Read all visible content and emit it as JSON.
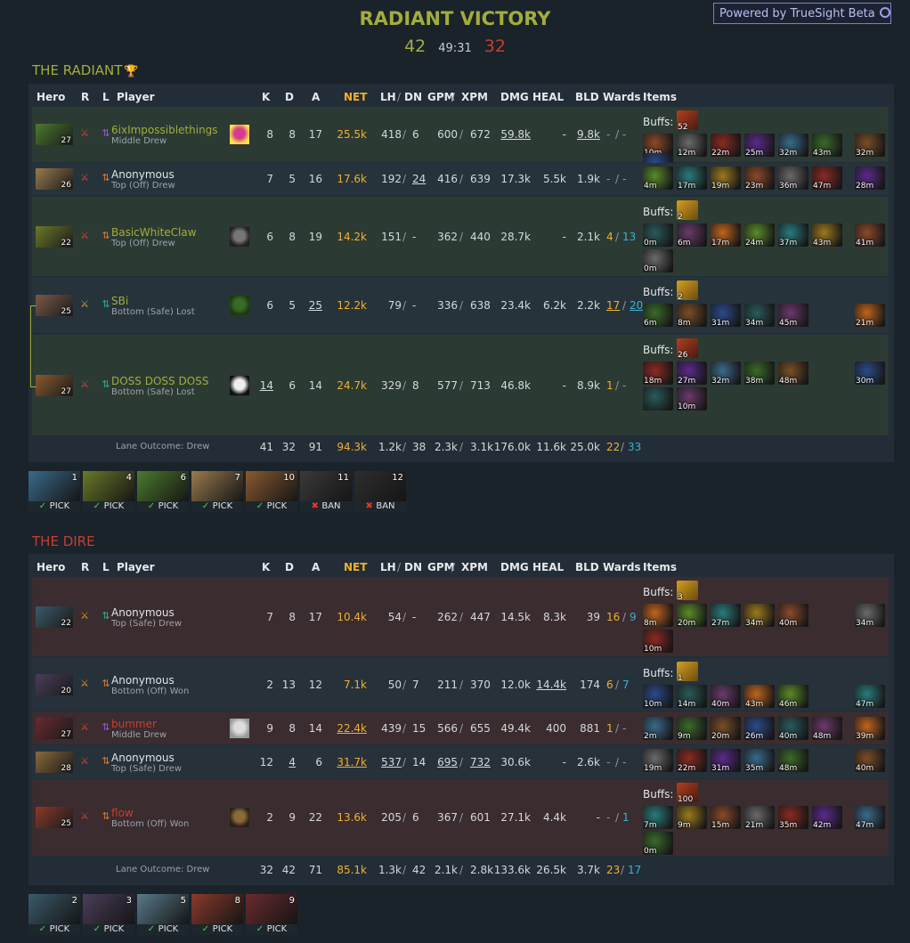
{
  "powered": "Powered by TrueSight Beta",
  "title": "RADIANT VICTORY",
  "score": {
    "radiant": "42",
    "duration": "49:31",
    "dire": "32"
  },
  "radiant_title": "THE RADIANT",
  "dire_title": "THE DIRE",
  "headers": {
    "hero": "Hero",
    "r": "R",
    "l": "L",
    "player": "Player",
    "k": "K",
    "d": "D",
    "a": "A",
    "net": "NET",
    "lh": "LH",
    "slash": "/",
    "dn": "DN",
    "gpm": "GPM",
    "xpm": "XPM",
    "dmg": "DMG",
    "heal": "HEAL",
    "bld": "BLD",
    "wards": "Wards",
    "items": "Items",
    "buffs": "Buffs:"
  },
  "radiant": {
    "players": [
      {
        "level": "27",
        "name": "6ixImpossiblethings",
        "name_class": "rad",
        "lane": "Middle Drew",
        "k": "8",
        "d": "8",
        "a": "17",
        "net": "25.5k",
        "lh": "418",
        "dn": "6",
        "gpm": "600",
        "xpm": "672",
        "dmg": "59.8k",
        "heal": "-",
        "bld": "9.8k",
        "w1": "-",
        "w2": "-",
        "buff_times": [
          "52"
        ],
        "item_times": [
          "10m",
          "12m",
          "22m",
          "25m",
          "32m",
          "43m",
          "32m",
          "",
          "",
          ""
        ]
      },
      {
        "level": "26",
        "name": "Anonymous",
        "name_class": "anon",
        "lane": "Top (Off) Drew",
        "k": "7",
        "d": "5",
        "a": "16",
        "net": "17.6k",
        "lh": "192",
        "dn": "24",
        "gpm": "416",
        "xpm": "639",
        "dmg": "17.3k",
        "heal": "5.5k",
        "bld": "1.9k",
        "w1": "-",
        "w2": "-",
        "buff_times": [],
        "item_times": [
          "4m",
          "17m",
          "19m",
          "23m",
          "36m",
          "47m",
          "28m"
        ]
      },
      {
        "level": "22",
        "name": "BasicWhiteClaw",
        "name_class": "rad",
        "lane": "Top (Off) Drew",
        "k": "6",
        "d": "8",
        "a": "19",
        "net": "14.2k",
        "lh": "151",
        "dn": "-",
        "gpm": "362",
        "xpm": "440",
        "dmg": "28.7k",
        "heal": "-",
        "bld": "2.1k",
        "w1": "4",
        "w2": "13",
        "buff_times": [
          "2"
        ],
        "item_times": [
          "0m",
          "6m",
          "17m",
          "24m",
          "37m",
          "43m",
          "41m",
          "0m"
        ]
      },
      {
        "level": "25",
        "name": "SBi",
        "name_class": "rad",
        "lane": "Bottom (Safe) Lost",
        "k": "6",
        "d": "5",
        "a": "25",
        "net": "12.2k",
        "lh": "79",
        "dn": "-",
        "gpm": "336",
        "xpm": "638",
        "dmg": "23.4k",
        "heal": "6.2k",
        "bld": "2.2k",
        "w1": "17",
        "w2": "20",
        "buff_times": [
          "2"
        ],
        "item_times": [
          "6m",
          "8m",
          "31m",
          "34m",
          "45m",
          "21m"
        ]
      },
      {
        "level": "27",
        "name": "DOSS DOSS DOSS",
        "name_class": "rad",
        "lane": "Bottom (Safe) Lost",
        "k": "14",
        "d": "6",
        "a": "14",
        "net": "24.7k",
        "lh": "329",
        "dn": "8",
        "gpm": "577",
        "xpm": "713",
        "dmg": "46.8k",
        "heal": "-",
        "bld": "8.9k",
        "w1": "1",
        "w2": "-",
        "buff_times": [
          "26"
        ],
        "item_times": [
          "18m",
          "27m",
          "32m",
          "38m",
          "48m",
          "30m",
          "",
          "10m"
        ]
      }
    ],
    "totals": {
      "lane_outcome": "Lane Outcome: Drew",
      "k": "41",
      "d": "32",
      "a": "91",
      "net": "94.3k",
      "lh": "1.2k",
      "dn": "38",
      "gpm": "2.3k",
      "xpm": "3.1k",
      "dmg": "176.0k",
      "heal": "11.6k",
      "bld": "25.0k",
      "w1": "22",
      "w2": "33"
    },
    "draft": [
      {
        "order": "1",
        "action": "PICK"
      },
      {
        "order": "4",
        "action": "PICK"
      },
      {
        "order": "6",
        "action": "PICK"
      },
      {
        "order": "7",
        "action": "PICK"
      },
      {
        "order": "10",
        "action": "PICK"
      },
      {
        "order": "11",
        "action": "BAN"
      },
      {
        "order": "12",
        "action": "BAN"
      }
    ]
  },
  "dire": {
    "players": [
      {
        "level": "22",
        "name": "Anonymous",
        "name_class": "anon",
        "lane": "Top (Safe) Drew",
        "k": "7",
        "d": "8",
        "a": "17",
        "net": "10.4k",
        "lh": "54",
        "dn": "-",
        "gpm": "262",
        "xpm": "447",
        "dmg": "14.5k",
        "heal": "8.3k",
        "bld": "39",
        "w1": "16",
        "w2": "9",
        "buff_times": [
          "3"
        ],
        "item_times": [
          "8m",
          "20m",
          "27m",
          "34m",
          "40m",
          "34m",
          "10m"
        ]
      },
      {
        "level": "20",
        "name": "Anonymous",
        "name_class": "anon",
        "lane": "Bottom (Off) Won",
        "k": "2",
        "d": "13",
        "a": "12",
        "net": "7.1k",
        "lh": "50",
        "dn": "7",
        "gpm": "211",
        "xpm": "370",
        "dmg": "12.0k",
        "heal": "14.4k",
        "bld": "174",
        "w1": "6",
        "w2": "7",
        "buff_times": [
          "1"
        ],
        "item_times": [
          "10m",
          "14m",
          "40m",
          "43m",
          "46m",
          "47m"
        ]
      },
      {
        "level": "27",
        "name": "bummer",
        "name_class": "dir",
        "lane": "Middle Drew",
        "k": "9",
        "d": "8",
        "a": "14",
        "net": "22.4k",
        "lh": "439",
        "dn": "15",
        "gpm": "566",
        "xpm": "655",
        "dmg": "49.4k",
        "heal": "400",
        "bld": "881",
        "w1": "1",
        "w2": "-",
        "buff_times": [],
        "item_times": [
          "2m",
          "9m",
          "20m",
          "26m",
          "40m",
          "48m",
          "39m"
        ]
      },
      {
        "level": "28",
        "name": "Anonymous",
        "name_class": "anon",
        "lane": "Top (Safe) Drew",
        "k": "12",
        "d": "4",
        "a": "6",
        "net": "31.7k",
        "lh": "537",
        "dn": "14",
        "gpm": "695",
        "xpm": "732",
        "dmg": "30.6k",
        "heal": "-",
        "bld": "2.6k",
        "w1": "-",
        "w2": "-",
        "buff_times": [],
        "item_times": [
          "19m",
          "22m",
          "31m",
          "35m",
          "48m",
          "40m"
        ]
      },
      {
        "level": "25",
        "name": "flow",
        "name_class": "dir",
        "lane": "Bottom (Off) Won",
        "k": "2",
        "d": "9",
        "a": "22",
        "net": "13.6k",
        "lh": "205",
        "dn": "6",
        "gpm": "367",
        "xpm": "601",
        "dmg": "27.1k",
        "heal": "4.4k",
        "bld": "-",
        "w1": "-",
        "w2": "1",
        "buff_times": [
          "100"
        ],
        "item_times": [
          "7m",
          "9m",
          "15m",
          "21m",
          "35m",
          "42m",
          "47m",
          "0m"
        ]
      }
    ],
    "totals": {
      "lane_outcome": "Lane Outcome: Drew",
      "k": "32",
      "d": "42",
      "a": "71",
      "net": "85.1k",
      "lh": "1.3k",
      "dn": "42",
      "gpm": "2.1k",
      "xpm": "2.8k",
      "dmg": "133.6k",
      "heal": "26.5k",
      "bld": "3.7k",
      "w1": "23",
      "w2": "17"
    },
    "draft": [
      {
        "order": "2",
        "action": "PICK"
      },
      {
        "order": "3",
        "action": "PICK"
      },
      {
        "order": "5",
        "action": "PICK"
      },
      {
        "order": "8",
        "action": "PICK"
      },
      {
        "order": "9",
        "action": "PICK"
      }
    ]
  },
  "colors": {
    "radiant": "#a3ad3b",
    "dire": "#c43f33",
    "net": "#f0b030",
    "wards_obs": "#f0b030",
    "wards_sen": "#36b3d4"
  }
}
